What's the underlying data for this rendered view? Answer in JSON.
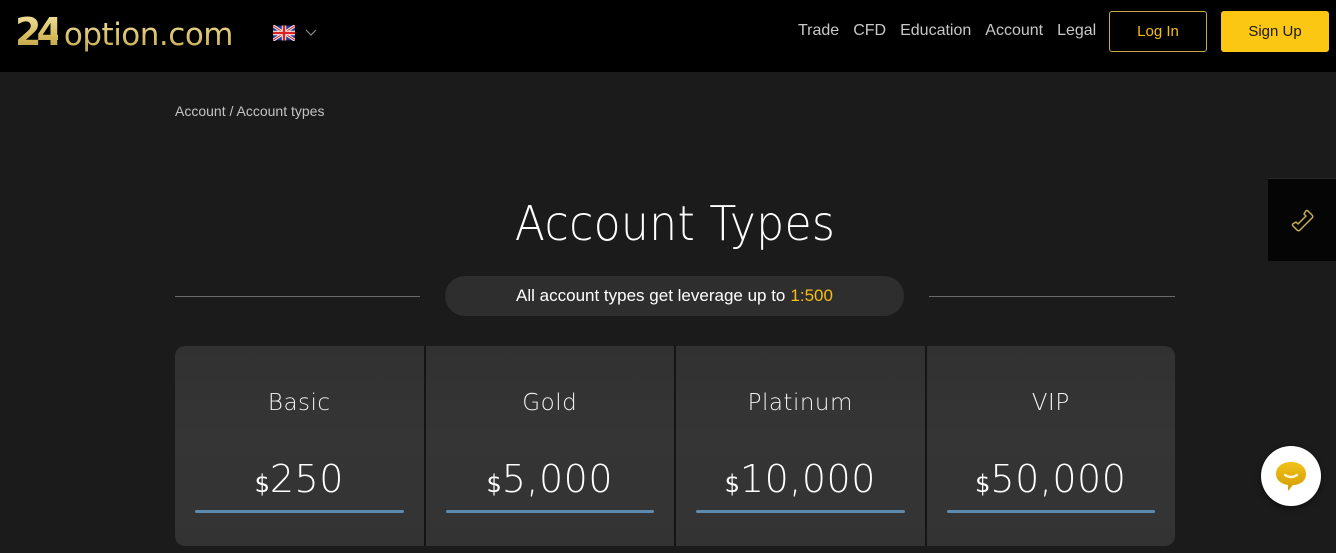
{
  "header": {
    "logo_number": "24",
    "logo_word": "option.com",
    "language_icon": "uk-flag-icon",
    "nav": [
      {
        "label": "Trade"
      },
      {
        "label": "CFD"
      },
      {
        "label": "Education"
      },
      {
        "label": "Account"
      },
      {
        "label": "Legal"
      }
    ],
    "login_label": "Log In",
    "signup_label": "Sign Up"
  },
  "breadcrumb": {
    "parent": "Account",
    "separator": " / ",
    "current": "Account types"
  },
  "main": {
    "title": "Account Types",
    "leverage_text": "All account types get leverage up to",
    "leverage_value": "1:500",
    "accounts": [
      {
        "name": "Basic",
        "currency": "$",
        "amount": "250"
      },
      {
        "name": "Gold",
        "currency": "$",
        "amount": "5,000"
      },
      {
        "name": "Platinum",
        "currency": "$",
        "amount": "10,000"
      },
      {
        "name": "VIP",
        "currency": "$",
        "amount": "50,000"
      }
    ]
  },
  "colors": {
    "accent_yellow": "#fcc713",
    "login_border": "#c9a94a",
    "card_bar": "#5d8bb0",
    "background": "#1b1b1b",
    "topbar": "#000000"
  },
  "widgets": {
    "phone_icon": "phone-icon",
    "chat_icon": "chat-bubble-icon"
  }
}
